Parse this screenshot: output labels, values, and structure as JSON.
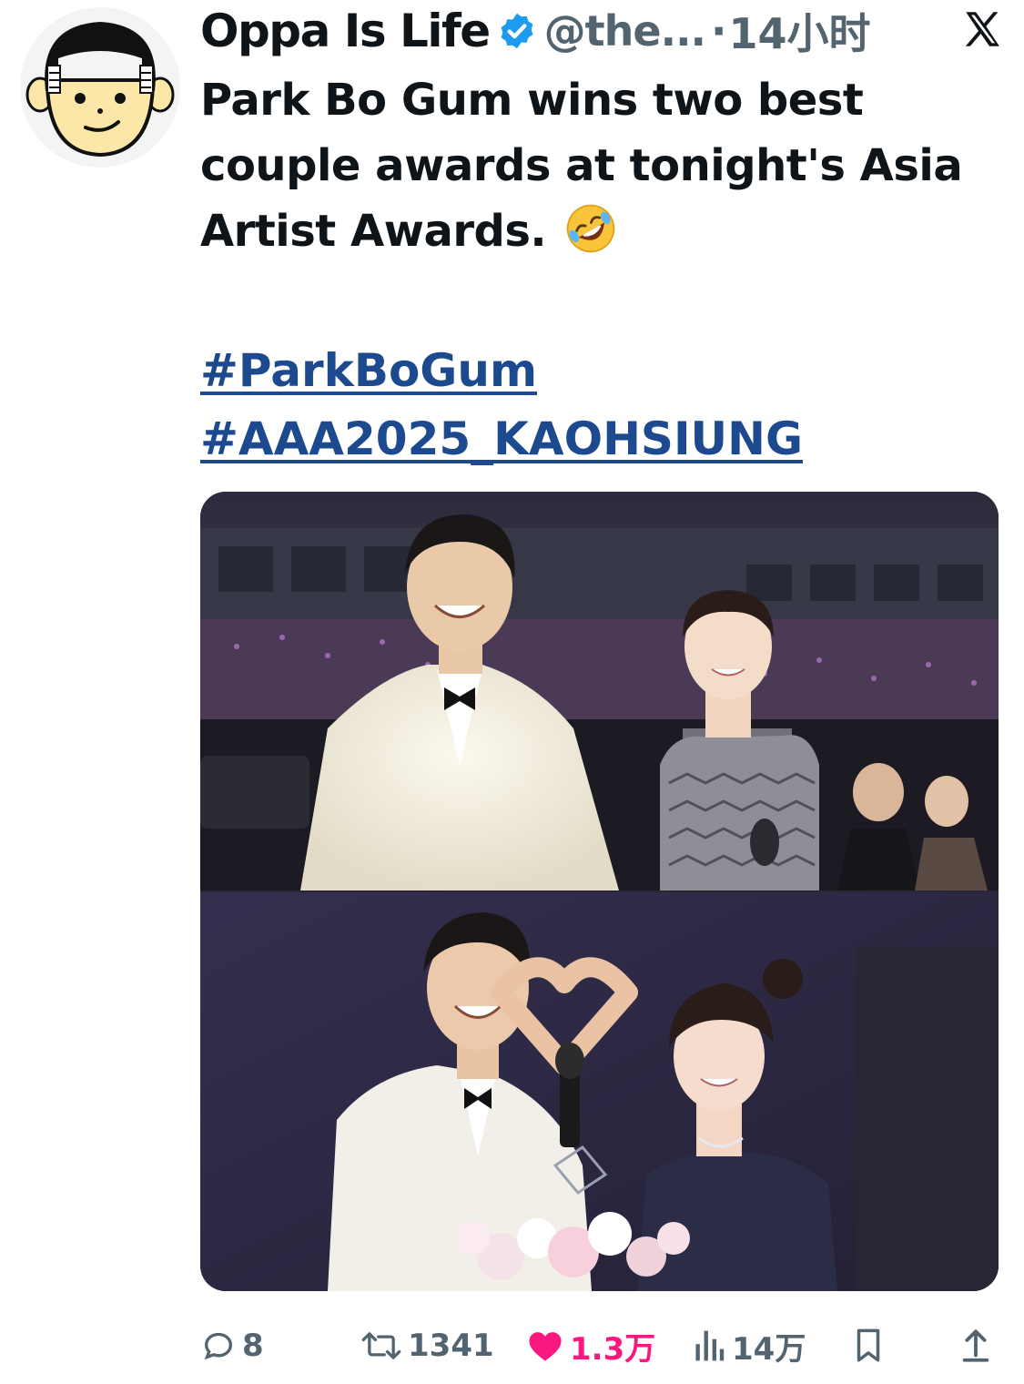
{
  "author": {
    "display_name": "Oppa Is Life",
    "handle": "@the...",
    "separator": "·",
    "time": "14小时",
    "verified": true,
    "avatar_icon": "cartoon-face-avatar"
  },
  "platform_icon": "x-logo-icon",
  "tweet": {
    "text": "Park Bo Gum wins two best couple awards at tonight's Asia Artist Awards.",
    "emoji": "rolling-on-floor-laughing-emoji",
    "hashtags": [
      "#ParkBoGum",
      "#AAA2025_KAOHSIUNG"
    ]
  },
  "media": {
    "photos": [
      {
        "description_icon": "award-ceremony-photo-1"
      },
      {
        "description_icon": "award-ceremony-photo-2"
      }
    ]
  },
  "actions": {
    "replies": "8",
    "reposts": "1341",
    "likes": "1.3万",
    "views": "14万",
    "like_color": "#f91880"
  },
  "colors": {
    "hashtag": "#1d4a8e",
    "secondary_text": "#536471",
    "verified": "#1d9bf0"
  }
}
